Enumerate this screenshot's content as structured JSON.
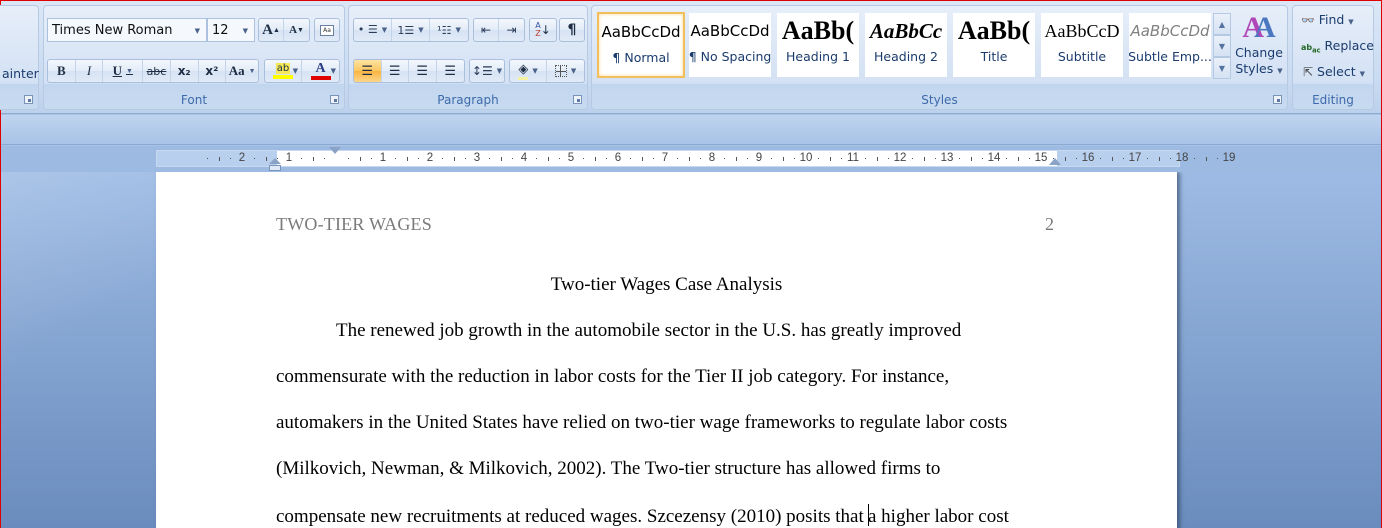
{
  "ribbon": {
    "clipboard": {
      "format_painter_partial": "ainter"
    },
    "font": {
      "label": "Font",
      "font_name": "Times New Roman",
      "font_size": "12",
      "grow_font": "A",
      "shrink_font": "A",
      "bold": "B",
      "italic": "I",
      "underline": "U",
      "strikethrough": "abc",
      "subscript": "x₂",
      "superscript": "x²",
      "change_case": "Aa",
      "highlight_color": "#ffff00",
      "font_color": "#e00000"
    },
    "paragraph": {
      "label": "Paragraph",
      "pilcrow": "¶"
    },
    "styles": {
      "label": "Styles",
      "gallery": [
        {
          "sample": "AaBbCcDd",
          "name": "¶ Normal",
          "selected": true
        },
        {
          "sample": "AaBbCcDd",
          "name": "¶ No Spacing"
        },
        {
          "sample": "AaBb(",
          "name": "Heading 1"
        },
        {
          "sample": "AaBbCc",
          "name": "Heading 2"
        },
        {
          "sample": "AaBb(",
          "name": "Title"
        },
        {
          "sample": "AaBbCcD",
          "name": "Subtitle"
        },
        {
          "sample": "AaBbCcDd",
          "name": "Subtle Emp..."
        }
      ],
      "change_styles_line1": "Change",
      "change_styles_line2": "Styles"
    },
    "editing": {
      "label": "Editing",
      "find": "Find",
      "replace": "Replace",
      "select": "Select"
    }
  },
  "ruler": {
    "left_labels": [
      "2",
      "1"
    ],
    "main_labels": [
      "1",
      "2",
      "3",
      "4",
      "5",
      "6",
      "7",
      "8",
      "9",
      "10",
      "11",
      "12",
      "13",
      "14",
      "15",
      "16"
    ],
    "right_labels": [
      "17",
      "18",
      "19"
    ]
  },
  "document": {
    "running_head": "TWO-TIER WAGES",
    "page_number": "2",
    "title": "Two-tier Wages Case Analysis",
    "lines": [
      "The renewed job growth in the automobile sector in the U.S. has greatly improved",
      "commensurate with the reduction in labor costs for the Tier II job category. For instance,",
      "automakers in the United States have relied on two-tier wage frameworks to regulate labor costs",
      "(Milkovich, Newman, & Milkovich, 2002). The Two-tier structure has allowed firms to",
      "compensate new recruitments at reduced wages. Szcezensy (2010) posits that ",
      "a higher labor cost"
    ]
  }
}
